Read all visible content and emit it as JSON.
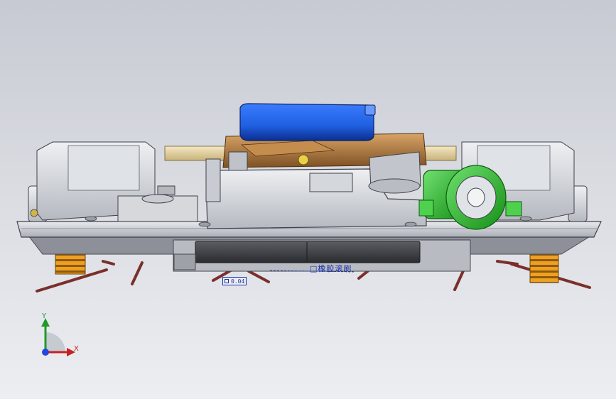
{
  "annotations": {
    "dimension_value": "0.04",
    "note_text": "□橡胶滚刷"
  },
  "triad": {
    "y_label": "Y",
    "x_label": "X"
  },
  "colors": {
    "background_top": "#c7cad2",
    "background_bottom": "#eceef2",
    "fan_blue": "#1f5fe0",
    "motor_green": "#22b022",
    "bracket_bronze": "#b07a3c",
    "wheel_orange": "#f0a020",
    "brush_red": "#8a3a34",
    "annotation_blue": "#1a33aa"
  },
  "icons": [
    "coordinate-triad-icon"
  ]
}
